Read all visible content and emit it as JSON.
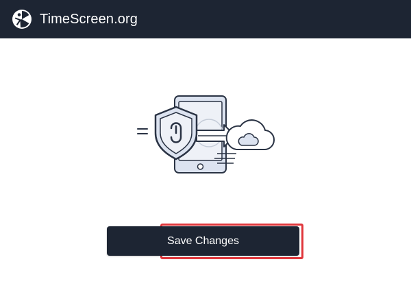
{
  "header": {
    "site_name": "TimeScreen.org",
    "logo_icon": "timescreen-logo-icon"
  },
  "illustration": {
    "icon": "secure-cloud-sync-icon"
  },
  "actions": {
    "save_label": "Save Changes"
  },
  "colors": {
    "header_bg": "#1d2533",
    "button_bg": "#1d2533",
    "focus_outline": "#e0363b",
    "illustration_fill": "#dce3f0",
    "illustration_stroke": "#2a3344"
  }
}
